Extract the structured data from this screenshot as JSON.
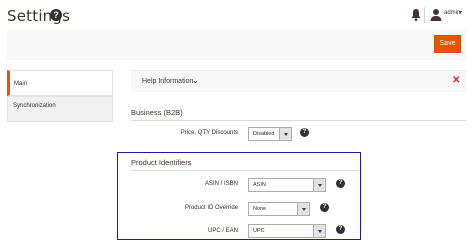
{
  "header": {
    "title": "Settings",
    "help_glyph": "?",
    "user_name": "admin",
    "user_caret": "▾"
  },
  "icons": {
    "help": "question-circle-icon",
    "notifications": "bell-icon",
    "user": "user-icon",
    "help_info_toggle": "chevron-down-icon",
    "help_info_close": "close-icon"
  },
  "actions": {
    "save_label": "Save"
  },
  "tabs": [
    {
      "label": "Main",
      "active": true
    },
    {
      "label": "Synchronization",
      "active": false
    }
  ],
  "help_info": {
    "label": "Help Information",
    "chevron": "⌄",
    "close": "✕"
  },
  "business": {
    "title": "Business (B2B)",
    "fields": [
      {
        "label": "Price, QTY Discounts",
        "value": "Disabled"
      }
    ]
  },
  "product_identifiers": {
    "title": "Product Identifiers",
    "fields": [
      {
        "label": "ASIN / ISBN",
        "value": "ASIN"
      },
      {
        "label": "Product ID Override",
        "value": "None"
      },
      {
        "label": "UPC / EAN",
        "value": "UPC"
      }
    ]
  },
  "colors": {
    "accent": "#eb5202",
    "highlight_border": "#1a1aaa",
    "close": "#e22626"
  }
}
